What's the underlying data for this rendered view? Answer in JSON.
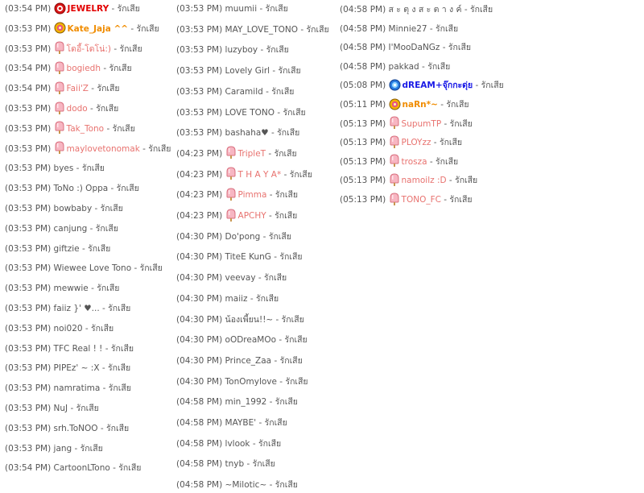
{
  "status_text": "รักเสีย",
  "separator": " - ",
  "colors": {
    "normal": "#555555",
    "pink": "#e8726f",
    "red": "#e20000",
    "orange": "#f08c00",
    "blue": "#1a1ae6"
  },
  "columns": [
    {
      "entries": [
        {
          "time": "(03:54 PM)",
          "name": "JEWELRY",
          "style": "red",
          "icon": "red-flower-icon"
        },
        {
          "time": "(03:53 PM)",
          "name": "Kate_Jaja ^^",
          "style": "orange",
          "icon": "yellow-flower-icon"
        },
        {
          "time": "(03:53 PM)",
          "name": "โดอี้-โดโน่:)",
          "style": "pink",
          "icon": "popsicle-icon"
        },
        {
          "time": "(03:54 PM)",
          "name": "bogiedh",
          "style": "pink",
          "icon": "popsicle-icon"
        },
        {
          "time": "(03:54 PM)",
          "name": "Faii'Z",
          "style": "pink",
          "icon": "popsicle-icon"
        },
        {
          "time": "(03:53 PM)",
          "name": "dodo",
          "style": "pink",
          "icon": "popsicle-icon"
        },
        {
          "time": "(03:53 PM)",
          "name": "Tak_Tono",
          "style": "pink",
          "icon": "popsicle-icon"
        },
        {
          "time": "(03:53 PM)",
          "name": "maylovetonomak",
          "style": "pink",
          "icon": "popsicle-icon"
        },
        {
          "time": "(03:53 PM)",
          "name": "byes",
          "style": "normal",
          "icon": ""
        },
        {
          "time": "(03:53 PM)",
          "name": "ToNo :) Oppa",
          "style": "normal",
          "icon": ""
        },
        {
          "time": "(03:53 PM)",
          "name": "bowbaby",
          "style": "normal",
          "icon": ""
        },
        {
          "time": "(03:53 PM)",
          "name": "canjung",
          "style": "normal",
          "icon": ""
        },
        {
          "time": "(03:53 PM)",
          "name": "giftzie",
          "style": "normal",
          "icon": ""
        },
        {
          "time": "(03:53 PM)",
          "name": "Wiewee Love Tono",
          "style": "normal",
          "icon": ""
        },
        {
          "time": "(03:53 PM)",
          "name": "mewwie",
          "style": "normal",
          "icon": ""
        },
        {
          "time": "(03:53 PM)",
          "name": "faiiz }' ♥...",
          "style": "normal",
          "icon": ""
        },
        {
          "time": "(03:53 PM)",
          "name": "noi020",
          "style": "normal",
          "icon": ""
        },
        {
          "time": "(03:53 PM)",
          "name": "TFC Real ! !",
          "style": "normal",
          "icon": ""
        },
        {
          "time": "(03:53 PM)",
          "name": "PIPEz' ~ :X",
          "style": "normal",
          "icon": ""
        },
        {
          "time": "(03:53 PM)",
          "name": "namratima",
          "style": "normal",
          "icon": ""
        },
        {
          "time": "(03:53 PM)",
          "name": "NuJ",
          "style": "normal",
          "icon": ""
        },
        {
          "time": "(03:53 PM)",
          "name": "srh.ToNOO",
          "style": "normal",
          "icon": ""
        },
        {
          "time": "(03:53 PM)",
          "name": "jang",
          "style": "normal",
          "icon": ""
        },
        {
          "time": "(03:54 PM)",
          "name": "CartoonLTono",
          "style": "normal",
          "icon": ""
        }
      ]
    },
    {
      "entries": [
        {
          "time": "(03:53 PM)",
          "name": "muumii",
          "style": "normal",
          "icon": ""
        },
        {
          "time": "(03:53 PM)",
          "name": "MAY_LOVE_TONO",
          "style": "normal",
          "icon": ""
        },
        {
          "time": "(03:53 PM)",
          "name": "luzyboy",
          "style": "normal",
          "icon": ""
        },
        {
          "time": "(03:53 PM)",
          "name": "Lovely Girl",
          "style": "normal",
          "icon": ""
        },
        {
          "time": "(03:53 PM)",
          "name": "Caramild",
          "style": "normal",
          "icon": ""
        },
        {
          "time": "(03:53 PM)",
          "name": "LOVE TONO",
          "style": "normal",
          "icon": ""
        },
        {
          "time": "(03:53 PM)",
          "name": "bashaha♥",
          "style": "normal",
          "icon": ""
        },
        {
          "time": "(04:23 PM)",
          "name": "TripleT",
          "style": "pink",
          "icon": "popsicle-icon"
        },
        {
          "time": "(04:23 PM)",
          "name": "T H A Y A*",
          "style": "pink",
          "icon": "popsicle-icon"
        },
        {
          "time": "(04:23 PM)",
          "name": "Pimma",
          "style": "pink",
          "icon": "popsicle-icon"
        },
        {
          "time": "(04:23 PM)",
          "name": "APCHY",
          "style": "pink",
          "icon": "popsicle-icon"
        },
        {
          "time": "(04:30 PM)",
          "name": "Do'pong",
          "style": "normal",
          "icon": ""
        },
        {
          "time": "(04:30 PM)",
          "name": "TiteE KunG",
          "style": "normal",
          "icon": ""
        },
        {
          "time": "(04:30 PM)",
          "name": "veevay",
          "style": "normal",
          "icon": ""
        },
        {
          "time": "(04:30 PM)",
          "name": "maiiz",
          "style": "normal",
          "icon": ""
        },
        {
          "time": "(04:30 PM)",
          "name": "น้องเพี้ยน!!~",
          "style": "normal",
          "icon": ""
        },
        {
          "time": "(04:30 PM)",
          "name": "oODreaMOo",
          "style": "normal",
          "icon": ""
        },
        {
          "time": "(04:30 PM)",
          "name": "Prince_Zaa",
          "style": "normal",
          "icon": ""
        },
        {
          "time": "(04:30 PM)",
          "name": "TonOmylove",
          "style": "normal",
          "icon": ""
        },
        {
          "time": "(04:58 PM)",
          "name": "min_1992",
          "style": "normal",
          "icon": ""
        },
        {
          "time": "(04:58 PM)",
          "name": "MAYBE'",
          "style": "normal",
          "icon": ""
        },
        {
          "time": "(04:58 PM)",
          "name": "lvlook",
          "style": "normal",
          "icon": ""
        },
        {
          "time": "(04:58 PM)",
          "name": "tnyb",
          "style": "normal",
          "icon": ""
        },
        {
          "time": "(04:58 PM)",
          "name": "~Milotic~",
          "style": "normal",
          "icon": ""
        }
      ]
    },
    {
      "entries": [
        {
          "time": "(04:58 PM)",
          "name": "ส ะ ตุ ง ส ะ ต า ง ค์",
          "style": "normal",
          "icon": ""
        },
        {
          "time": "(04:58 PM)",
          "name": "Minnie27",
          "style": "normal",
          "icon": ""
        },
        {
          "time": "(04:58 PM)",
          "name": "I'MooDaNGz",
          "style": "normal",
          "icon": ""
        },
        {
          "time": "(04:58 PM)",
          "name": "pakkad",
          "style": "normal",
          "icon": ""
        },
        {
          "time": "(05:08 PM)",
          "name": "dREAM+จุ๊กกะดุ่ย",
          "style": "blue",
          "icon": "blue-flower-icon"
        },
        {
          "time": "(05:11 PM)",
          "name": "naRn*~",
          "style": "orange",
          "icon": "yellow-flower-icon"
        },
        {
          "time": "(05:13 PM)",
          "name": "SupumTP",
          "style": "pink",
          "icon": "popsicle-icon"
        },
        {
          "time": "(05:13 PM)",
          "name": "PLOYzz",
          "style": "pink",
          "icon": "popsicle-icon"
        },
        {
          "time": "(05:13 PM)",
          "name": "trosza",
          "style": "pink",
          "icon": "popsicle-icon"
        },
        {
          "time": "(05:13 PM)",
          "name": "namoilz :D",
          "style": "pink",
          "icon": "popsicle-icon"
        },
        {
          "time": "(05:13 PM)",
          "name": "TONO_FC",
          "style": "pink",
          "icon": "popsicle-icon"
        }
      ]
    }
  ]
}
